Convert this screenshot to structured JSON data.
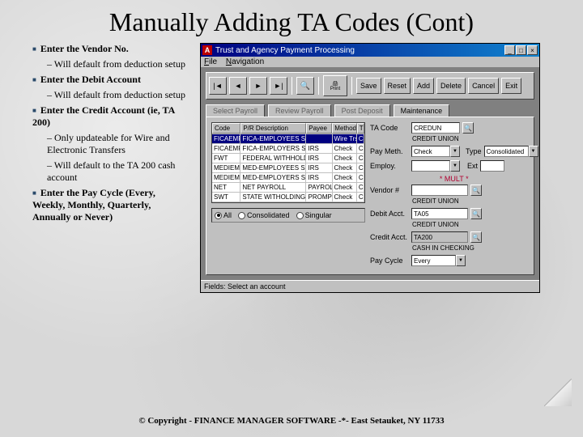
{
  "slide": {
    "title": "Manually Adding TA Codes (Cont)",
    "footer": "© Copyright - FINANCE MANAGER SOFTWARE -*- East Setauket, NY 11733"
  },
  "bullets": {
    "b1": "Enter the Vendor No.",
    "b1s1": "Will default from deduction setup",
    "b2": "Enter the Debit Account",
    "b2s1": "Will default from deduction setup",
    "b3": "Enter the Credit Account (ie, TA 200)",
    "b3s1": "Only updateable for Wire and Electronic Transfers",
    "b3s2": "Will default to the TA 200 cash account",
    "b4": "Enter the Pay Cycle (Every, Weekly, Monthly, Quarterly, Annually or Never)"
  },
  "window": {
    "title": "Trust and Agency Payment Processing",
    "menu": {
      "file": "File",
      "nav": "Navigation"
    },
    "print_label": "Print",
    "actions": {
      "save": "Save",
      "reset": "Reset",
      "add": "Add",
      "delete": "Delete",
      "cancel": "Cancel",
      "exit": "Exit"
    },
    "tabs": {
      "t1": "Select Payroll",
      "t2": "Review Payroll",
      "t3": "Post Deposit",
      "t4": "Maintenance"
    },
    "grid": {
      "headers": {
        "code": "Code",
        "desc": "P/R Description",
        "payee": "Payee",
        "method": "Method",
        "tf": "T"
      },
      "rows": [
        {
          "code": "FICAEMPL",
          "desc": "FICA-EMPLOYEES SHAIRS",
          "payee": "",
          "method": "Wire Trsfr",
          "tf": "C"
        },
        {
          "code": "FICAEMPR",
          "desc": "FICA-EMPLOYERS SHAIRS",
          "payee": "IRS",
          "method": "Check",
          "tf": "C"
        },
        {
          "code": "FWT",
          "desc": "FEDERAL WITHHOLD",
          "payee": "IRS",
          "method": "Check",
          "tf": "C"
        },
        {
          "code": "MEDIEMPL",
          "desc": "MED-EMPLOYEES SHRS",
          "payee": "IRS",
          "method": "Check",
          "tf": "C"
        },
        {
          "code": "MEDIEMPR",
          "desc": "MED-EMPLOYERS SHRS",
          "payee": "IRS",
          "method": "Check",
          "tf": "C"
        },
        {
          "code": "NET",
          "desc": "NET PAYROLL",
          "payee": "PAYROLL A",
          "method": "Check",
          "tf": "C"
        },
        {
          "code": "SWT",
          "desc": "STATE WITHOLDING",
          "payee": "PROMPT TA",
          "method": "Check",
          "tf": "C"
        }
      ]
    },
    "radios": {
      "all": "All",
      "cons": "Consolidated",
      "sing": "Singular"
    },
    "form": {
      "tacode_lbl": "TA Code",
      "tacode_val": "CREDUN",
      "desc_val": "CREDIT UNION",
      "paymeth_lbl": "Pay Meth.",
      "paymeth_val": "Check",
      "type_lbl": "Type",
      "type_val": "Consolidated",
      "employ_lbl": "Employ.",
      "employ_val": "",
      "ext_lbl": "Ext",
      "mult": "* MULT *",
      "vendor_lbl": "Vendor #",
      "vendor_val": "",
      "vendor_sub": "CREDIT UNION",
      "debit_lbl": "Debit Acct.",
      "debit_val": "TA05",
      "debit_sub": "CREDIT UNION",
      "credit_lbl": "Credit Acct.",
      "credit_val": "TA200",
      "credit_sub": "CASH IN CHECKING",
      "paycycle_lbl": "Pay Cycle",
      "paycycle_val": "Every"
    },
    "status": "Fields: Select an account"
  }
}
